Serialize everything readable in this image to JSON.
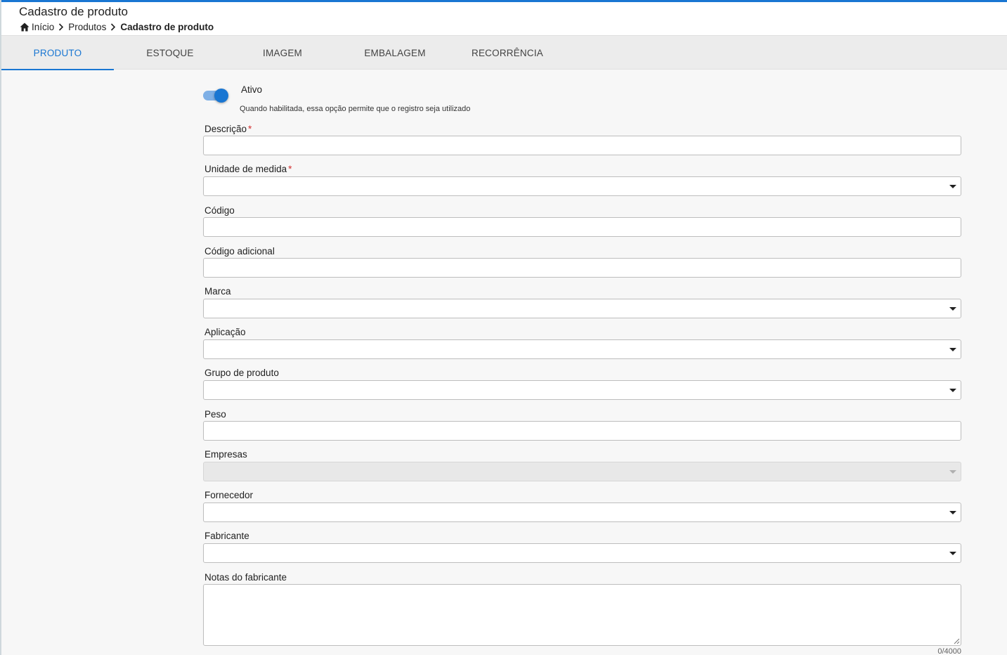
{
  "header": {
    "title": "Cadastro de produto",
    "breadcrumb": [
      "Início",
      "Produtos",
      "Cadastro de produto"
    ]
  },
  "tabs": [
    "PRODUTO",
    "ESTOQUE",
    "IMAGEM",
    "EMBALAGEM",
    "RECORRÊNCIA"
  ],
  "active_tab": "PRODUTO",
  "colors": {
    "accent": "#1976d2",
    "required": "#d32f2f"
  },
  "form": {
    "active_toggle": {
      "label": "Ativo",
      "hint": "Quando habilitada, essa opção permite que o registro seja utilizado",
      "checked": true
    },
    "fields": [
      {
        "label": "Descrição",
        "required": true,
        "type": "text",
        "value": ""
      },
      {
        "label": "Unidade de medida",
        "required": true,
        "type": "select",
        "value": ""
      },
      {
        "label": "Código",
        "required": false,
        "type": "text",
        "value": ""
      },
      {
        "label": "Código adicional",
        "required": false,
        "type": "text",
        "value": ""
      },
      {
        "label": "Marca",
        "required": false,
        "type": "select",
        "value": ""
      },
      {
        "label": "Aplicação",
        "required": false,
        "type": "select",
        "value": ""
      },
      {
        "label": "Grupo de produto",
        "required": false,
        "type": "select",
        "value": ""
      },
      {
        "label": "Peso",
        "required": false,
        "type": "text",
        "value": ""
      },
      {
        "label": "Empresas",
        "required": false,
        "type": "select",
        "disabled": true,
        "value": ""
      },
      {
        "label": "Fornecedor",
        "required": false,
        "type": "select",
        "value": ""
      },
      {
        "label": "Fabricante",
        "required": false,
        "type": "select",
        "value": ""
      }
    ],
    "notes": {
      "label": "Notas do fabricante",
      "value": "",
      "counter": "0/4000"
    }
  },
  "icons": {
    "home": "home-icon",
    "separator": "chevron-right-icon",
    "dropdown": "caret-down-icon"
  }
}
